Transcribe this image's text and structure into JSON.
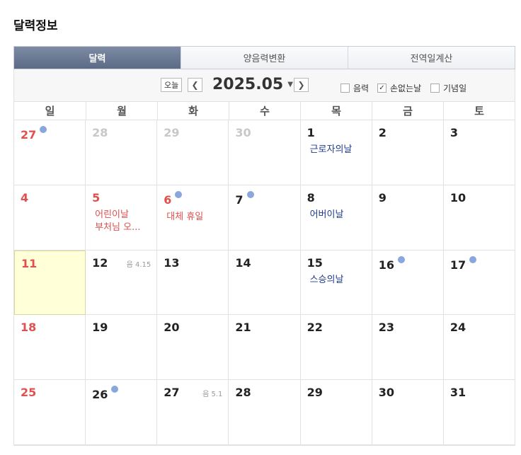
{
  "title": "달력정보",
  "tabs": [
    {
      "label": "달력",
      "active": true
    },
    {
      "label": "양음력변환",
      "active": false
    },
    {
      "label": "전역일계산",
      "active": false
    }
  ],
  "toolbar": {
    "today_label": "오늘",
    "prev_icon": "chevron-left-icon",
    "next_icon": "chevron-right-icon",
    "month": "2025.05",
    "options": [
      {
        "label": "음력",
        "checked": false
      },
      {
        "label": "손없는날",
        "checked": true
      },
      {
        "label": "기념일",
        "checked": false
      }
    ]
  },
  "weekdays": [
    "일",
    "월",
    "화",
    "수",
    "목",
    "금",
    "토"
  ],
  "colors": {
    "sunday": "#e0504e",
    "holiday_text": "#e0504e",
    "event_text": "#1e3c8c",
    "dot": "#89a6dd",
    "today_bg": "#ffffd8",
    "active_tab": "#5b6a86"
  },
  "weeks": [
    [
      {
        "day": "27",
        "other": true,
        "dot": true
      },
      {
        "day": "28",
        "other": true
      },
      {
        "day": "29",
        "other": true
      },
      {
        "day": "30",
        "other": true
      },
      {
        "day": "1",
        "events": [
          {
            "text": "근로자의날",
            "red": false
          }
        ]
      },
      {
        "day": "2"
      },
      {
        "day": "3"
      }
    ],
    [
      {
        "day": "4"
      },
      {
        "day": "5",
        "red": true,
        "events": [
          {
            "text": "어린이날",
            "red": true
          },
          {
            "text": "부처님 오...",
            "red": true
          }
        ]
      },
      {
        "day": "6",
        "red": true,
        "dot": true,
        "events": [
          {
            "text": "대체 휴일",
            "red": true
          }
        ]
      },
      {
        "day": "7",
        "dot": true
      },
      {
        "day": "8",
        "events": [
          {
            "text": "어버이날",
            "red": false
          }
        ]
      },
      {
        "day": "9"
      },
      {
        "day": "10"
      }
    ],
    [
      {
        "day": "11",
        "today": true
      },
      {
        "day": "12",
        "lunar": "음 4.15"
      },
      {
        "day": "13"
      },
      {
        "day": "14"
      },
      {
        "day": "15",
        "events": [
          {
            "text": "스승의날",
            "red": false
          }
        ]
      },
      {
        "day": "16",
        "dot": true
      },
      {
        "day": "17",
        "dot": true
      }
    ],
    [
      {
        "day": "18"
      },
      {
        "day": "19"
      },
      {
        "day": "20"
      },
      {
        "day": "21"
      },
      {
        "day": "22"
      },
      {
        "day": "23"
      },
      {
        "day": "24"
      }
    ],
    [
      {
        "day": "25"
      },
      {
        "day": "26",
        "dot": true
      },
      {
        "day": "27",
        "lunar": "음 5.1"
      },
      {
        "day": "28"
      },
      {
        "day": "29"
      },
      {
        "day": "30"
      },
      {
        "day": "31"
      }
    ]
  ]
}
